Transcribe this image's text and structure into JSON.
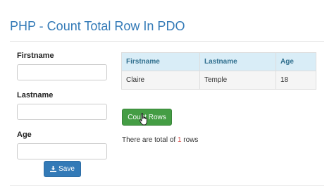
{
  "page": {
    "title": "PHP - Count Total Row In PDO"
  },
  "form": {
    "firstname_label": "Firstname",
    "lastname_label": "Lastname",
    "age_label": "Age",
    "firstname_value": "",
    "lastname_value": "",
    "age_value": "",
    "save_label": "Save"
  },
  "table": {
    "headers": [
      "Firstname",
      "Lastname",
      "Age"
    ],
    "rows": [
      [
        "Claire",
        "Temple",
        "18"
      ]
    ]
  },
  "count": {
    "button_label": "Count Rows",
    "result_prefix": "There are total of ",
    "result_value": "1",
    "result_suffix": " rows"
  },
  "colors": {
    "title": "#337ab7",
    "primary": "#337ab7",
    "success": "#449d44",
    "table_header_bg": "#d9edf7",
    "highlight": "#d9534f"
  },
  "icons": {
    "save": "download-icon",
    "cursor": "hand-pointer-icon"
  }
}
